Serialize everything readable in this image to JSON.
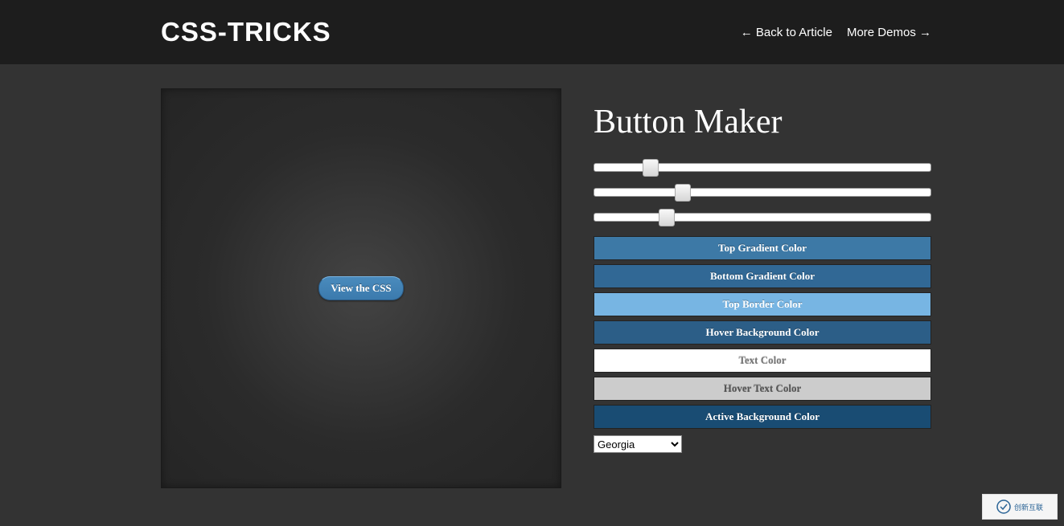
{
  "header": {
    "logo": "CSS-TRICKS",
    "back_link": "← Back to Article",
    "more_link": "More Demos →"
  },
  "preview": {
    "button_label": "View the CSS"
  },
  "controls": {
    "title": "Button Maker",
    "sliders": {
      "slider1": 15,
      "slider2": 25,
      "slider3": 20
    },
    "color_rows": [
      {
        "label": "Top Gradient Color",
        "bg": "#3d79a6",
        "fg": "#ffffff"
      },
      {
        "label": "Bottom Gradient Color",
        "bg": "#316895",
        "fg": "#ffffff"
      },
      {
        "label": "Top Border Color",
        "bg": "#77b5e3",
        "fg": "#ffffff"
      },
      {
        "label": "Hover Background Color",
        "bg": "#2c5e87",
        "fg": "#ffffff"
      },
      {
        "label": "Text Color",
        "bg": "#ffffff",
        "fg": "#777777"
      },
      {
        "label": "Hover Text Color",
        "bg": "#cccccc",
        "fg": "#555555"
      },
      {
        "label": "Active Background Color",
        "bg": "#194c73",
        "fg": "#ffffff"
      }
    ],
    "font_select": {
      "selected": "Georgia"
    }
  },
  "watermark": {
    "text": "创新互联"
  }
}
